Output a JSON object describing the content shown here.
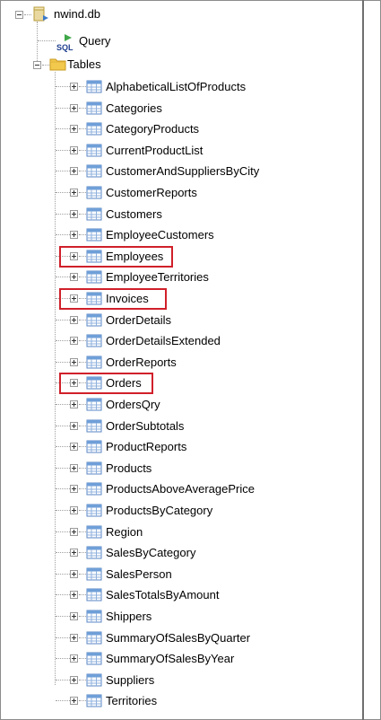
{
  "root": {
    "label": "nwind.db",
    "icon": "database-icon"
  },
  "query": {
    "label": "Query",
    "icon": "sql-query-icon"
  },
  "tables_folder": {
    "label": "Tables",
    "icon": "folder-icon"
  },
  "tables": [
    "AlphabeticalListOfProducts",
    "Categories",
    "CategoryProducts",
    "CurrentProductList",
    "CustomerAndSuppliersByCity",
    "CustomerReports",
    "Customers",
    "EmployeeCustomers",
    "Employees",
    "EmployeeTerritories",
    "Invoices",
    "OrderDetails",
    "OrderDetailsExtended",
    "OrderReports",
    "Orders",
    "OrdersQry",
    "OrderSubtotals",
    "ProductReports",
    "Products",
    "ProductsAboveAveragePrice",
    "ProductsByCategory",
    "Region",
    "SalesByCategory",
    "SalesPerson",
    "SalesTotalsByAmount",
    "Shippers",
    "SummaryOfSalesByQuarter",
    "SummaryOfSalesByYear",
    "Suppliers",
    "Territories"
  ],
  "highlighted_tables": [
    "Employees",
    "Invoices",
    "Orders"
  ],
  "colors": {
    "highlight": "#d0202a",
    "table_icon_header": "#6f9fd8",
    "folder": "#f2c94c"
  }
}
